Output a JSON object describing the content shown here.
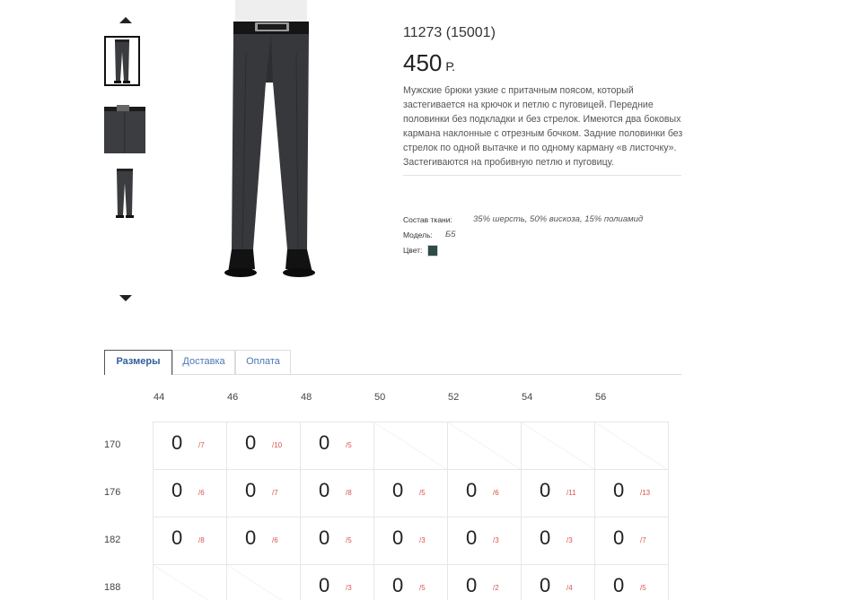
{
  "product": {
    "sku": "11273 (15001)",
    "price": "450",
    "currency": "Р.",
    "description": "Мужские брюки узкие с притачным поясом, который застегивается на крючок и петлю с пуговицей. Передние половинки без подкладки и без стрелок. Имеются два боковых кармана наклонные с отрезным бочком. Задние половинки без стрелок по одной вытачке и по одному карману «в листочку». Застегиваются на пробивную петлю и пуговицу.",
    "specs": {
      "composition_label": "Состав ткани:",
      "composition_value": "35% шерсть, 50% вискоза, 15% полиамид",
      "model_label": "Модель:",
      "model_value": "Б5",
      "color_label": "Цвет:",
      "color_hex": "#2f4a47"
    }
  },
  "gallery": {
    "thumb_icons": [
      "trousers-front-icon",
      "trousers-detail-icon",
      "trousers-back-icon"
    ],
    "active_thumb": 0
  },
  "tabs": [
    {
      "label": "Размеры",
      "active": true
    },
    {
      "label": "Доставка",
      "active": false
    },
    {
      "label": "Оплата",
      "active": false
    }
  ],
  "size_table": {
    "sizes": [
      "44",
      "46",
      "48",
      "50",
      "52",
      "54",
      "56"
    ],
    "heights": [
      "170",
      "176",
      "182",
      "188"
    ],
    "rows": [
      [
        {
          "qty": "0",
          "stock": "/7"
        },
        {
          "qty": "0",
          "stock": "/10"
        },
        {
          "qty": "0",
          "stock": "/5"
        },
        null,
        null,
        null,
        null
      ],
      [
        {
          "qty": "0",
          "stock": "/6"
        },
        {
          "qty": "0",
          "stock": "/7"
        },
        {
          "qty": "0",
          "stock": "/8"
        },
        {
          "qty": "0",
          "stock": "/5"
        },
        {
          "qty": "0",
          "stock": "/6"
        },
        {
          "qty": "0",
          "stock": "/11"
        },
        {
          "qty": "0",
          "stock": "/13"
        }
      ],
      [
        {
          "qty": "0",
          "stock": "/8"
        },
        {
          "qty": "0",
          "stock": "/6"
        },
        {
          "qty": "0",
          "stock": "/5"
        },
        {
          "qty": "0",
          "stock": "/3"
        },
        {
          "qty": "0",
          "stock": "/3"
        },
        {
          "qty": "0",
          "stock": "/3"
        },
        {
          "qty": "0",
          "stock": "/7"
        }
      ],
      [
        null,
        null,
        {
          "qty": "0",
          "stock": "/3"
        },
        {
          "qty": "0",
          "stock": "/5"
        },
        {
          "qty": "0",
          "stock": "/2"
        },
        {
          "qty": "0",
          "stock": "/4"
        },
        {
          "qty": "0",
          "stock": "/5"
        }
      ]
    ]
  }
}
